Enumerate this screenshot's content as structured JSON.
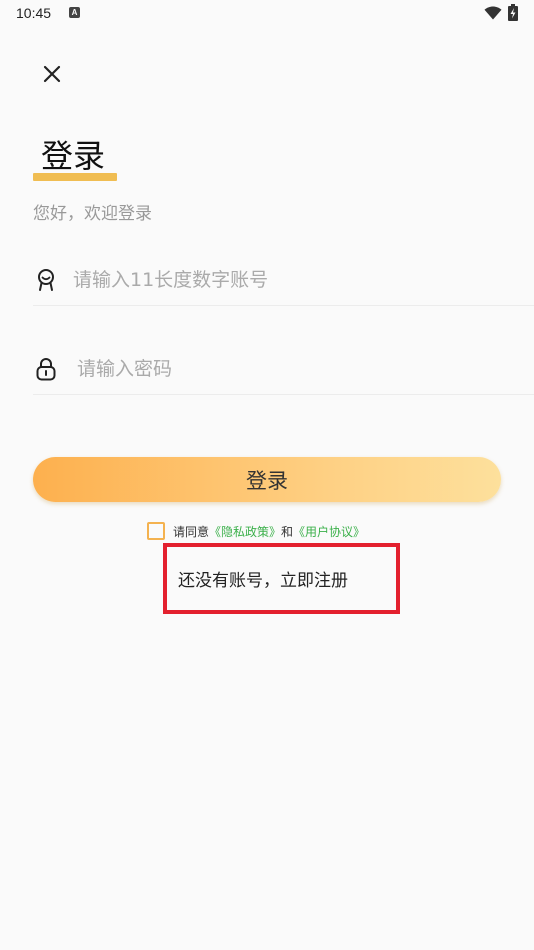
{
  "status_bar": {
    "time": "10:45",
    "notification_icon": "a-letter-icon",
    "notification_letter": "A",
    "wifi_icon": "wifi-icon",
    "battery_icon": "battery-charging-icon"
  },
  "header": {
    "close_icon": "close-icon"
  },
  "login": {
    "title": "登录",
    "subtitle": "您好，欢迎登录",
    "account": {
      "icon": "user-icon",
      "value": "",
      "placeholder": "请输入11长度数字账号"
    },
    "password": {
      "icon": "lock-icon",
      "value": "",
      "placeholder": "请输入密码"
    },
    "submit_label": "登录",
    "agreement": {
      "checked": false,
      "prefix": "请同意",
      "privacy_link": "《隐私政策》",
      "and_text": "和",
      "terms_link": "《用户协议》"
    },
    "register_link": "还没有账号，立即注册"
  },
  "colors": {
    "accent": "#f0bd52",
    "button_gradient_start": "#fdb04e",
    "button_gradient_end": "#fde09c",
    "link": "#3bb04a",
    "highlight": "#e3202e"
  }
}
